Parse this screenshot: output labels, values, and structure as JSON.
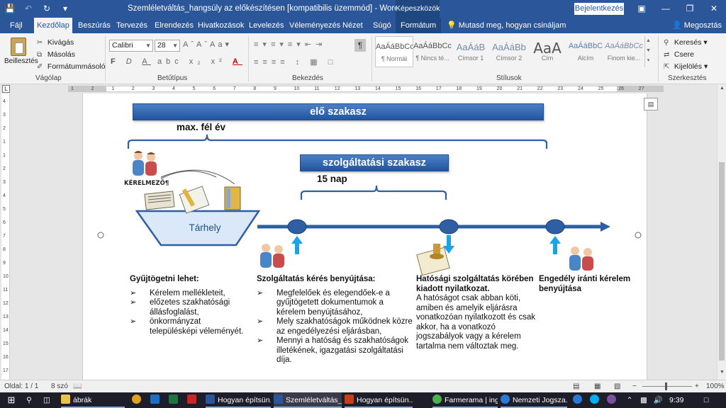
{
  "titlebar": {
    "document_title": "Szemléletváltás_hangsúly az előkészítésen [kompatibilis üzemmód] - Word",
    "context_group": "Képeszközök",
    "sign_in": "Bejelentkezés"
  },
  "tabs": [
    {
      "label": "Fájl"
    },
    {
      "label": "Kezdőlap"
    },
    {
      "label": "Beszúrás"
    },
    {
      "label": "Tervezés"
    },
    {
      "label": "Elrendezés"
    },
    {
      "label": "Hivatkozások"
    },
    {
      "label": "Levelezés"
    },
    {
      "label": "Véleményezés"
    },
    {
      "label": "Nézet"
    },
    {
      "label": "Súgó"
    },
    {
      "label": "Formátum"
    }
  ],
  "tell_me": "Mutasd meg, hogyan csináljam",
  "share": "Megosztás",
  "ribbon": {
    "clipboard": {
      "paste": "Beillesztés",
      "cut": "Kivágás",
      "copy": "Másolás",
      "format_painter": "Formátummásoló",
      "group": "Vágólap"
    },
    "font": {
      "name": "Calibri",
      "size": "28",
      "group": "Betűtípus"
    },
    "paragraph": {
      "group": "Bekezdés"
    },
    "styles": {
      "group": "Stílusok",
      "items": [
        {
          "preview": "AaÁáBbCc",
          "name": "¶ Normál"
        },
        {
          "preview": "AaÁáBbCc",
          "name": "¶ Nincs té..."
        },
        {
          "preview": "AaÁáB",
          "name": "Címsor 1"
        },
        {
          "preview": "AaÁáBb",
          "name": "Címsor 2"
        },
        {
          "preview": "AaA",
          "name": "Cím"
        },
        {
          "preview": "AaÁáBbC",
          "name": "Alcím"
        },
        {
          "preview": "AaÁáBbCc",
          "name": "Finom kie..."
        }
      ]
    },
    "editing": {
      "find": "Keresés",
      "replace": "Csere",
      "select": "Kijelölés",
      "group": "Szerkesztés"
    }
  },
  "ruler": {
    "ticks": [
      "1",
      "2",
      "1",
      "2",
      "3",
      "4",
      "5",
      "6",
      "7",
      "8",
      "9",
      "10",
      "11",
      "12",
      "13",
      "14",
      "15",
      "16",
      "17",
      "18",
      "19",
      "20",
      "21",
      "22",
      "23",
      "24",
      "25",
      "26",
      "27"
    ],
    "vticks": [
      "4",
      "3",
      "2",
      "1",
      "1",
      "2",
      "3",
      "4",
      "5",
      "6",
      "7",
      "8",
      "9",
      "10",
      "11",
      "12",
      "13",
      "14",
      "15",
      "16",
      "17"
    ]
  },
  "diagram": {
    "pre_phase": "elő szakasz",
    "pre_duration": "max. fél év",
    "service_phase": "szolgáltatási szakasz",
    "service_duration": "15 nap",
    "applicant": "KÉRELMEZŐ¶",
    "storage": "Tárhely",
    "columns": [
      {
        "title": "Gyűjtögetni lehet:",
        "items": [
          "Kérelem mellékleteit,",
          "előzetes szakhatósági állásfoglalást,",
          "önkormányzat településképi véleményét."
        ]
      },
      {
        "title": "Szolgáltatás kérés benyújtása:",
        "items": [
          "Megfelelőek és elegendőek-e a gyűjtögetett dokumentumok a kérelem benyújtásához,",
          "Mely szakhatóságok működnek közre az engedélyezési eljárásban,",
          "Mennyi a hatóság és szakhatóságok illetékének, igazgatási szolgáltatási díja."
        ]
      },
      {
        "title": "Hatósági szolgáltatás körében kiadott nyilatkozat.",
        "text": "A hatóságot csak abban köti, amiben és amelyik eljárásra vonatkozóan nyilatkozott és csak akkor, ha a vonatkozó jogszabályok vagy a kérelem tartalma nem változtak meg."
      },
      {
        "title": "Engedély iránti kérelem benyújtása"
      }
    ]
  },
  "status": {
    "page": "Oldal: 1 / 1",
    "words": "8 szó",
    "zoom": "100%"
  },
  "taskbar": {
    "items": [
      {
        "label": "ábrák"
      },
      {
        "label": "Hogyan építsün..."
      },
      {
        "label": "Szemléletváltás_..."
      },
      {
        "label": "Hogyan építsün..."
      },
      {
        "label": "Farmerama | ing..."
      },
      {
        "label": "Nemzeti Jogsza..."
      }
    ],
    "clock": "9:39"
  },
  "colors": {
    "word_blue": "#2b579a",
    "banner_blue": "#2e66b0",
    "timeline_blue": "#2f5fa3",
    "arrow_cyan": "#1aa3e8"
  }
}
